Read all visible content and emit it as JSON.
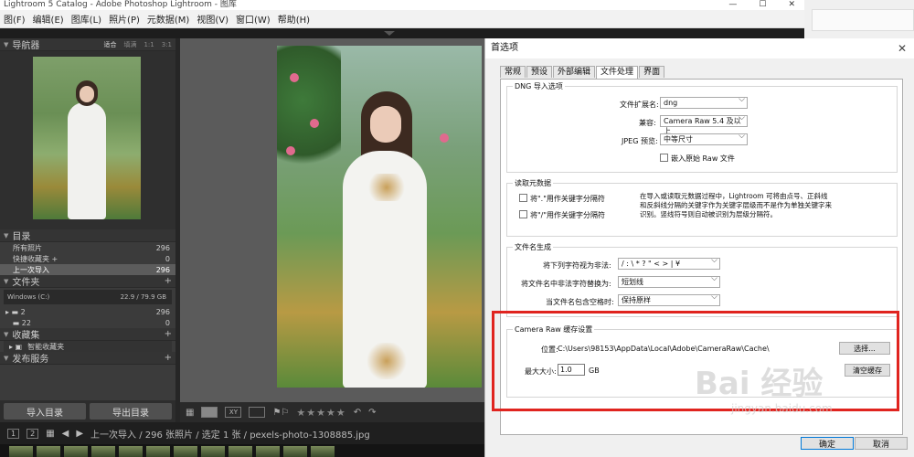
{
  "window": {
    "title": "Lightroom 5 Catalog - Adobe Photoshop Lightroom - 图库",
    "controls": [
      "—",
      "☐",
      "✕"
    ]
  },
  "menu": [
    "图(F)",
    "编辑(E)",
    "图库(L)",
    "照片(P)",
    "元数据(M)",
    "视图(V)",
    "窗口(W)",
    "帮助(H)"
  ],
  "navigator": {
    "title": "导航器",
    "options": [
      "适合",
      "填满",
      "1:1",
      "3:1"
    ]
  },
  "catalog": {
    "title": "目录",
    "items": [
      {
        "label": "所有照片",
        "count": "296"
      },
      {
        "label": "快捷收藏夹 +",
        "count": "0"
      },
      {
        "label": "上一次导入",
        "count": "296"
      }
    ]
  },
  "folders": {
    "title": "文件夹",
    "volume": {
      "label": "Windows (C:)",
      "info": "22.9 / 79.9 GB"
    },
    "items": [
      {
        "label": "2",
        "count": "296"
      },
      {
        "label": "22",
        "count": "0"
      }
    ]
  },
  "collections": {
    "title": "收藏集",
    "items": [
      "智能收藏夹"
    ]
  },
  "publish": {
    "title": "发布服务"
  },
  "buttons": {
    "import": "导入目录",
    "export": "导出目录"
  },
  "toolbar": {
    "stars": "★★★★★",
    "view_xy": "XY"
  },
  "filmstrip": {
    "page": "2",
    "breadcrumb": "上一次导入 / 296 张照片 / 选定 1 张 / pexels-photo-1308885.jpg"
  },
  "dialog": {
    "title": "首选项",
    "close": "✕",
    "tabs": [
      "常规",
      "预设",
      "外部编辑",
      "文件处理",
      "界面"
    ],
    "selected_tab": "文件处理",
    "dng": {
      "legend": "DNG 导入选项",
      "ext_label": "文件扩展名:",
      "ext_value": "dng",
      "compat_label": "兼容:",
      "compat_value": "Camera Raw 5.4 及以上",
      "jpeg_label": "JPEG 预览:",
      "jpeg_value": "中等尺寸",
      "embed_label": "嵌入原始 Raw 文件"
    },
    "metadata": {
      "legend": "读取元数据",
      "opt1": "将\".\"用作关键字分隔符",
      "opt2": "将\"/\"用作关键字分隔符",
      "note": "在导入或读取元数据过程中，Lightroom 可将由点号、正斜线和反斜线分隔的关键字作为关键字层级而不是作为单独关键字来识别。竖线符号则自动被识别为层级分隔符。"
    },
    "filename": {
      "legend": "文件名生成",
      "illegal_label": "将下列字符视为非法:",
      "illegal_value": "/ : \\ * ? \" < > | ¥",
      "replace_label": "将文件名中非法字符替换为:",
      "replace_value": "短划线",
      "space_label": "当文件名包含空格时:",
      "space_value": "保持原样"
    },
    "cache": {
      "legend": "Camera Raw 缓存设置",
      "location_label": "位置:",
      "location_value": "C:\\Users\\98153\\AppData\\Local\\Adobe\\CameraRaw\\Cache\\",
      "choose_button": "选择...",
      "maxsize_label": "最大大小:",
      "maxsize_value": "1.0",
      "maxsize_unit": "GB",
      "purge_button": "清空缓存"
    },
    "ok": "确定",
    "cancel": "取消"
  },
  "watermark": {
    "main": "Bai 经验",
    "sub": "jingyan.baidu.com"
  },
  "colors": {
    "highlight": "#e0241f",
    "panel_bg": "#3b3b3b"
  }
}
